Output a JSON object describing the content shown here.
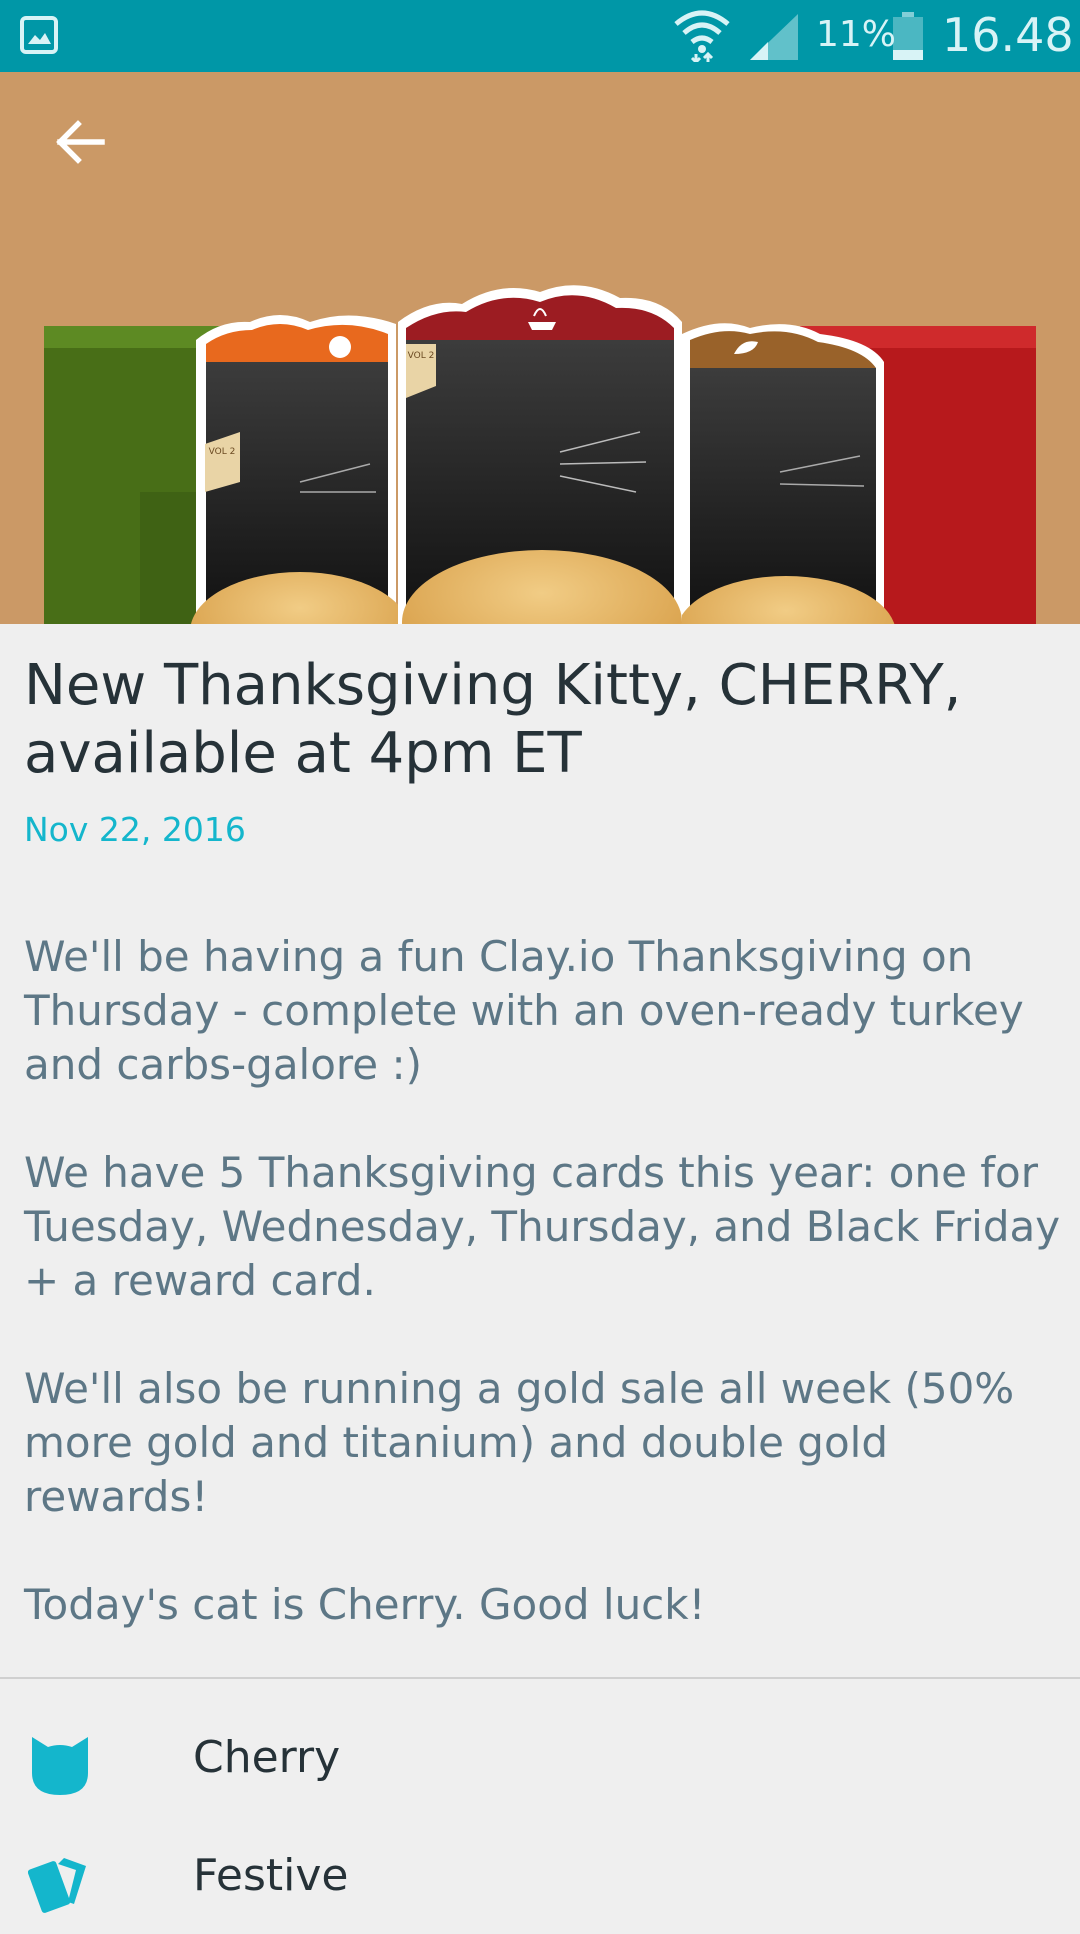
{
  "status_bar": {
    "gallery_icon": "image-icon",
    "wifi_icon": "wifi-icon",
    "signal_icon": "signal-icon",
    "battery_percent": "11%",
    "battery_icon": "battery-icon",
    "time": "16.48"
  },
  "header": {
    "back_icon": "arrow-left-icon",
    "card_badges": [
      "VOL 2",
      "VOL 2"
    ]
  },
  "article": {
    "title": "New Thanksgiving Kitty, CHERRY, available at 4pm ET",
    "date": "Nov 22, 2016",
    "paragraphs": [
      "We'll be having a fun Clay.io Thanksgiving on Thursday - complete with an oven-ready turkey and carbs-galore :)",
      "We have 5 Thanksgiving cards this year: one for Tuesday, Wednesday, Thursday, and Black Friday + a reward card.",
      "We'll also be running a gold sale all week (50% more gold and titanium) and double gold rewards!",
      "Today's cat is Cherry. Good luck!"
    ]
  },
  "tags": [
    {
      "label": "Cherry",
      "icon": "cat-icon"
    },
    {
      "label": "Festive",
      "icon": "cards-icon"
    }
  ],
  "colors": {
    "status_bar": "#0097a7",
    "hero_bg": "#cb9966",
    "accent": "#14b6cc",
    "title": "#263238",
    "body": "#5d7786"
  }
}
